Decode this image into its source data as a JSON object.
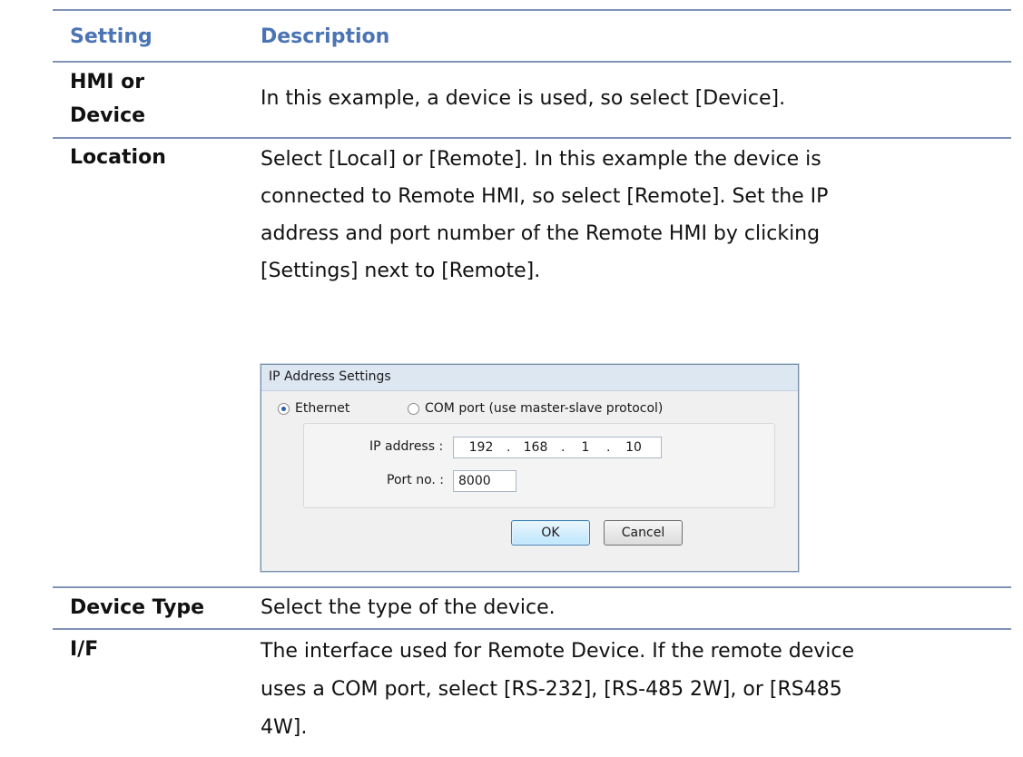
{
  "table": {
    "header": {
      "setting": "Setting",
      "description": "Description"
    },
    "rows": [
      {
        "setting_lines": [
          "HMI or",
          "Device"
        ],
        "description": "In this example, a device is used, so select [Device]."
      },
      {
        "setting": "Location",
        "description_lines": [
          "Select [Local] or [Remote]. In this example the device is",
          "connected to Remote HMI, so select [Remote]. Set the IP",
          "address and port number of the Remote HMI by clicking",
          "[Settings] next to [Remote]."
        ]
      },
      {
        "setting": "Device Type",
        "description": "Select the type of the device."
      },
      {
        "setting": "I/F",
        "description_lines": [
          "The interface used for Remote Device. If the remote device",
          "uses a COM port, select [RS-232], [RS-485 2W], or [RS485",
          "4W]."
        ]
      }
    ]
  },
  "dialog": {
    "title": "IP Address Settings",
    "radio_ethernet": "Ethernet",
    "radio_com": "COM port (use master-slave protocol)",
    "selected": "Ethernet",
    "ip_label": "IP address :",
    "ip": [
      "192",
      "168",
      "1",
      "10"
    ],
    "port_label": "Port no. :",
    "port": "8000",
    "ok": "OK",
    "cancel": "Cancel"
  }
}
